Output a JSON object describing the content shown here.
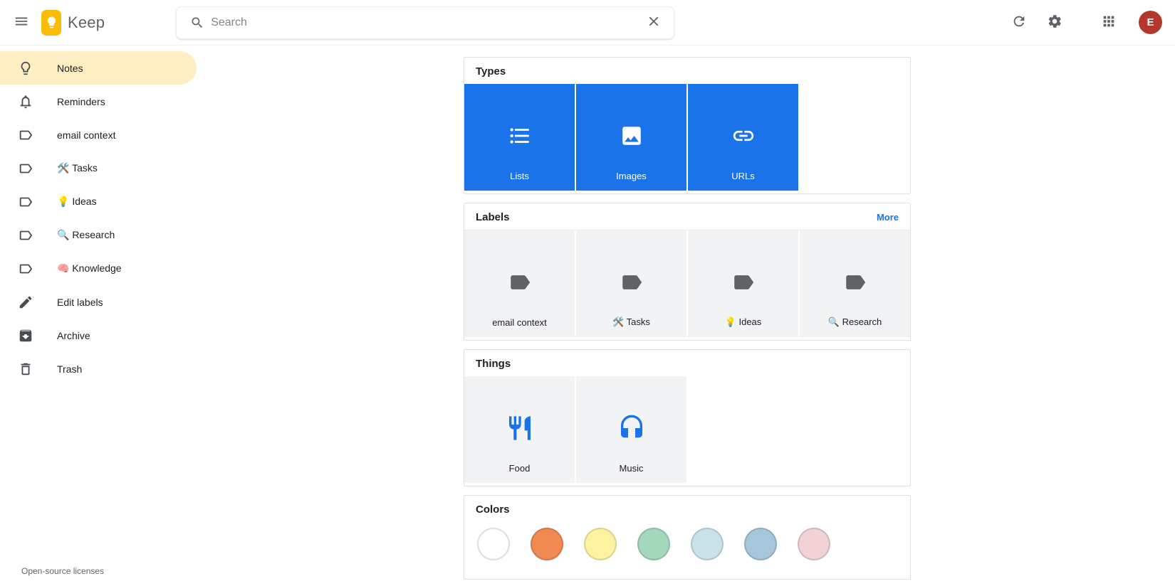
{
  "topbar": {
    "app_name": "Keep",
    "search": {
      "placeholder": "Search"
    },
    "avatar_letter": "E",
    "avatar_color": "#b4372e"
  },
  "sidebar": {
    "items": [
      {
        "label": "Notes",
        "active": true
      },
      {
        "label": "Reminders"
      },
      {
        "label": "email context"
      },
      {
        "label": "🛠️ Tasks"
      },
      {
        "label": "💡 Ideas"
      },
      {
        "label": "🔍 Research"
      },
      {
        "label": "🧠 Knowledge"
      },
      {
        "label": "Edit labels"
      },
      {
        "label": "Archive"
      },
      {
        "label": "Trash"
      }
    ],
    "footer_link": "Open-source licenses"
  },
  "sections": {
    "types": {
      "title": "Types",
      "tiles": [
        {
          "label": "Lists"
        },
        {
          "label": "Images"
        },
        {
          "label": "URLs"
        }
      ]
    },
    "labels": {
      "title": "Labels",
      "more_label": "More",
      "tiles": [
        {
          "label": "email context"
        },
        {
          "label": "🛠️ Tasks"
        },
        {
          "label": "💡 Ideas"
        },
        {
          "label": "🔍 Research"
        }
      ]
    },
    "things": {
      "title": "Things",
      "tiles": [
        {
          "label": "Food"
        },
        {
          "label": "Music"
        }
      ]
    },
    "colors": {
      "title": "Colors",
      "swatches": [
        {
          "name": "white",
          "hex": "#ffffff"
        },
        {
          "name": "orange",
          "hex": "#f08a52"
        },
        {
          "name": "yellow",
          "hex": "#fbf3a0"
        },
        {
          "name": "green",
          "hex": "#a5d7bc"
        },
        {
          "name": "light-blue",
          "hex": "#c9e2ea"
        },
        {
          "name": "steel-blue",
          "hex": "#a6c6db"
        },
        {
          "name": "pink",
          "hex": "#f2d2d5"
        }
      ]
    }
  },
  "theme": {
    "accent_blue": "#1a73e8",
    "active_item_bg": "#feefc3",
    "tile_bg": "#f1f3f4",
    "logo_yellow": "#fbbc04"
  }
}
